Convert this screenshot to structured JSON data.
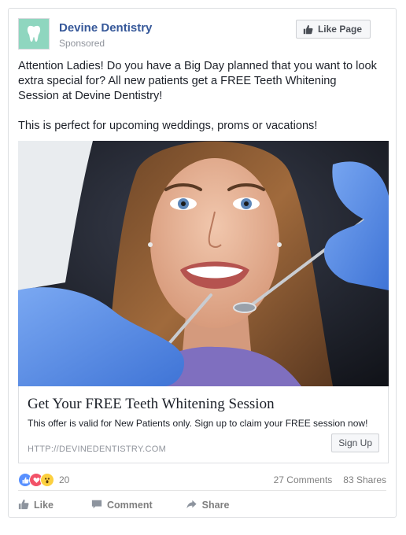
{
  "post": {
    "page_name": "Devine Dentistry",
    "sponsored_label": "Sponsored",
    "like_page_label": "Like Page",
    "body_line_1": "Attention Ladies! Do you have a Big Day planned that you want to look extra special for? All new patients get a FREE Teeth Whitening Session at Devine Dentistry!",
    "body_line_2": "This is perfect for upcoming weddings, proms or vacations!"
  },
  "link_preview": {
    "headline": "Get Your FREE Teeth Whitening Session",
    "description": "This offer is valid for New Patients only. Sign up to claim your FREE session now!",
    "domain": "HTTP://DEVINEDENTISTRY.COM",
    "cta_label": "Sign Up"
  },
  "engagement": {
    "reaction_count": "20",
    "comments": "27 Comments",
    "shares": "83 Shares",
    "reactions": [
      "like-icon",
      "love-icon",
      "wow-icon"
    ]
  },
  "actions": {
    "like": "Like",
    "comment": "Comment",
    "share": "Share"
  },
  "colors": {
    "page_name": "#365899",
    "avatar_bg": "#8fd6bf",
    "glove_blue": "#5a8fe6",
    "meta_grey": "#90949c"
  }
}
